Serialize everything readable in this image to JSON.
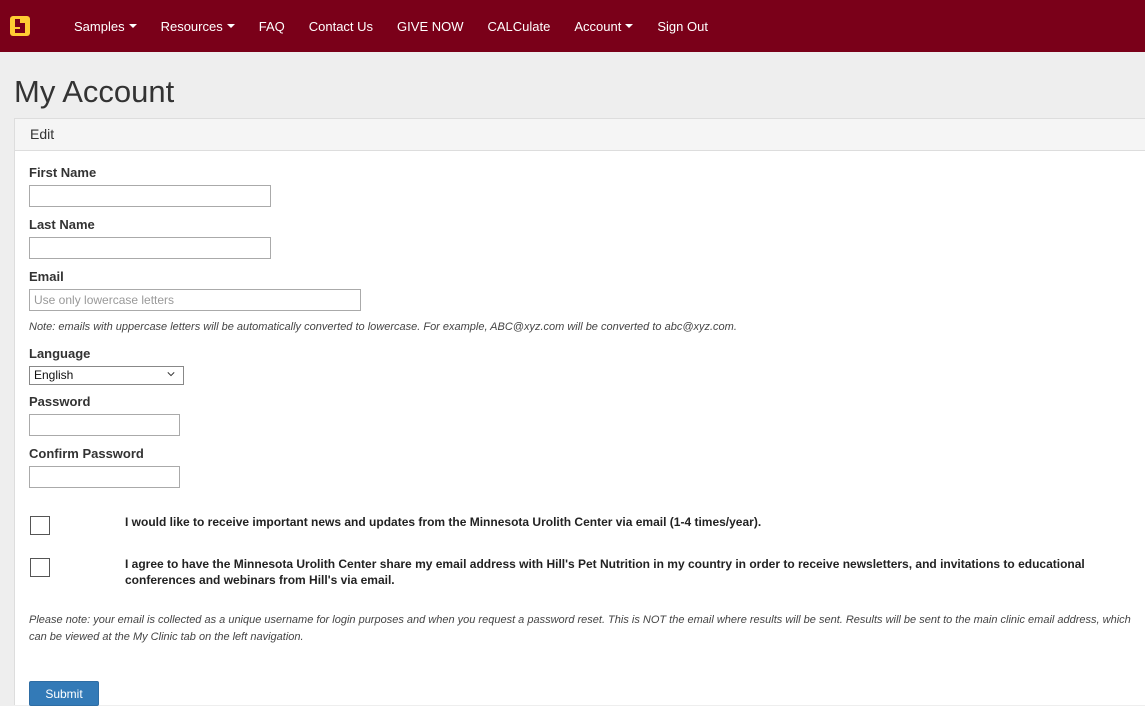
{
  "nav": {
    "logo": "gold-block-m-logo",
    "items": [
      {
        "label": "Samples",
        "dropdown": true
      },
      {
        "label": "Resources",
        "dropdown": true
      },
      {
        "label": "FAQ",
        "dropdown": false
      },
      {
        "label": "Contact Us",
        "dropdown": false
      },
      {
        "label": "GIVE NOW",
        "dropdown": false
      },
      {
        "label": "CALCulate",
        "dropdown": false
      },
      {
        "label": "Account",
        "dropdown": true
      },
      {
        "label": "Sign Out",
        "dropdown": false
      }
    ]
  },
  "page": {
    "title": "My Account"
  },
  "panel": {
    "heading": "Edit"
  },
  "form": {
    "first_name": {
      "label": "First Name",
      "value": ""
    },
    "last_name": {
      "label": "Last Name",
      "value": ""
    },
    "email": {
      "label": "Email",
      "value": "",
      "placeholder": "Use only lowercase letters"
    },
    "email_note": "Note: emails with uppercase letters will be automatically converted to lowercase. For example, ABC@xyz.com will be converted to abc@xyz.com.",
    "language": {
      "label": "Language",
      "selected": "English"
    },
    "password": {
      "label": "Password",
      "value": ""
    },
    "confirm_password": {
      "label": "Confirm Password",
      "value": ""
    },
    "consent_news": {
      "checked": false,
      "text": "I would like to receive important news and updates from the Minnesota Urolith Center via email (1-4 times/year)."
    },
    "consent_share": {
      "checked": false,
      "text": "I agree to have the Minnesota Urolith Center share my email address with Hill's Pet Nutrition in my country in order to receive newsletters, and invitations to educational conferences and webinars from Hill's via email."
    },
    "privacy_note": "Please note: your email is collected as a unique username for login purposes and when you request a password reset. This is NOT the email where results will be sent. Results will be sent to the main clinic email address, which can be viewed at the My Clinic tab on the left navigation.",
    "submit_label": "Submit"
  },
  "colors": {
    "nav_bg": "#7a0019",
    "logo_gold": "#ffcc33",
    "button_blue": "#337ab7"
  }
}
